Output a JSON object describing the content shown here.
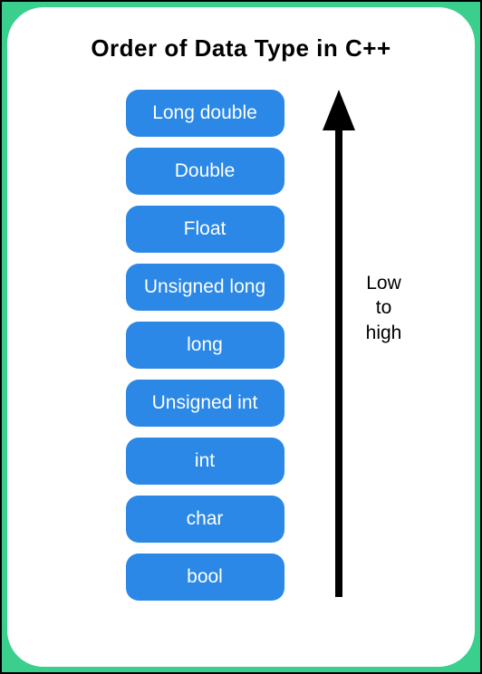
{
  "title": "Order of Data Type in C++",
  "types": [
    "Long double",
    "Double",
    "Float",
    "Unsigned long",
    "long",
    "Unsigned int",
    "int",
    "char",
    "bool"
  ],
  "arrow_label_lines": [
    "Low",
    "to",
    "high"
  ],
  "colors": {
    "accent": "#3bcf8e",
    "box": "#2b88e6",
    "box_text": "#ffffff"
  }
}
